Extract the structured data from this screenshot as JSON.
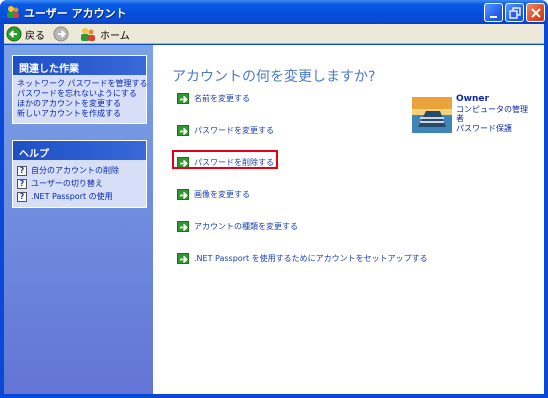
{
  "window": {
    "title": "ユーザー アカウント"
  },
  "toolbar": {
    "back_label": "戻る",
    "home_label": "ホーム"
  },
  "related_tasks": {
    "heading": "関連した作業",
    "items": [
      "ネットワーク パスワードを管理する",
      "パスワードを忘れないようにする",
      "ほかのアカウントを変更する",
      "新しいアカウントを作成する"
    ]
  },
  "help": {
    "heading": "ヘルプ",
    "items": [
      "自分のアカウントの削除",
      "ユーザーの切り替え",
      ".NET Passport の使用"
    ]
  },
  "main": {
    "title": "アカウントの何を変更しますか?",
    "links": [
      "名前を変更する",
      "パスワードを変更する",
      "パスワードを削除する",
      "画像を変更する",
      "アカウントの種類を変更する",
      ".NET Passport を使用するためにアカウントをセットアップする"
    ]
  },
  "user": {
    "name": "Owner",
    "role": "コンピュータの管理者",
    "status": "パスワード保護"
  },
  "colors": {
    "highlight_border": "#e30016",
    "link_text": "#1a3fae",
    "title_text": "#4b7ac8",
    "arrow_green": "#2e9a2e"
  }
}
